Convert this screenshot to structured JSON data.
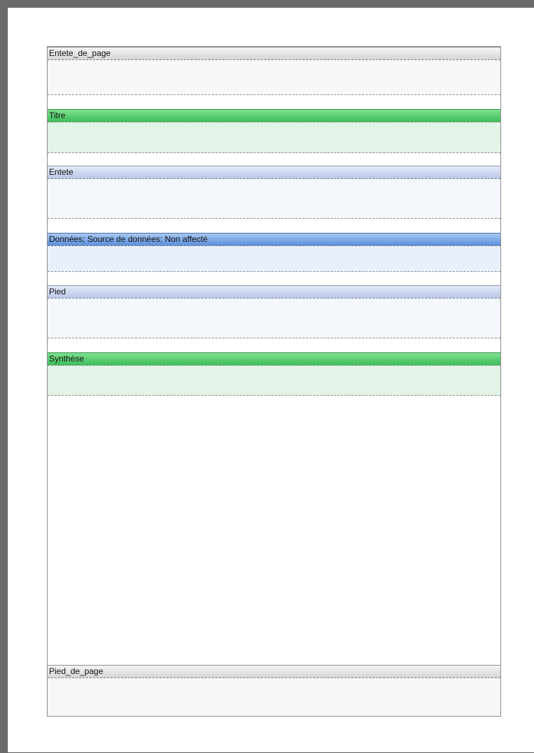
{
  "report": {
    "bands": [
      {
        "key": "page_header",
        "label": "Entete_de_page"
      },
      {
        "key": "title",
        "label": "Titre"
      },
      {
        "key": "header",
        "label": "Entete"
      },
      {
        "key": "data",
        "label": "Données; Source de données: Non affecté"
      },
      {
        "key": "footer",
        "label": "Pied"
      },
      {
        "key": "summary",
        "label": "Synthèse"
      },
      {
        "key": "page_footer",
        "label": "Pied_de_page"
      }
    ]
  }
}
